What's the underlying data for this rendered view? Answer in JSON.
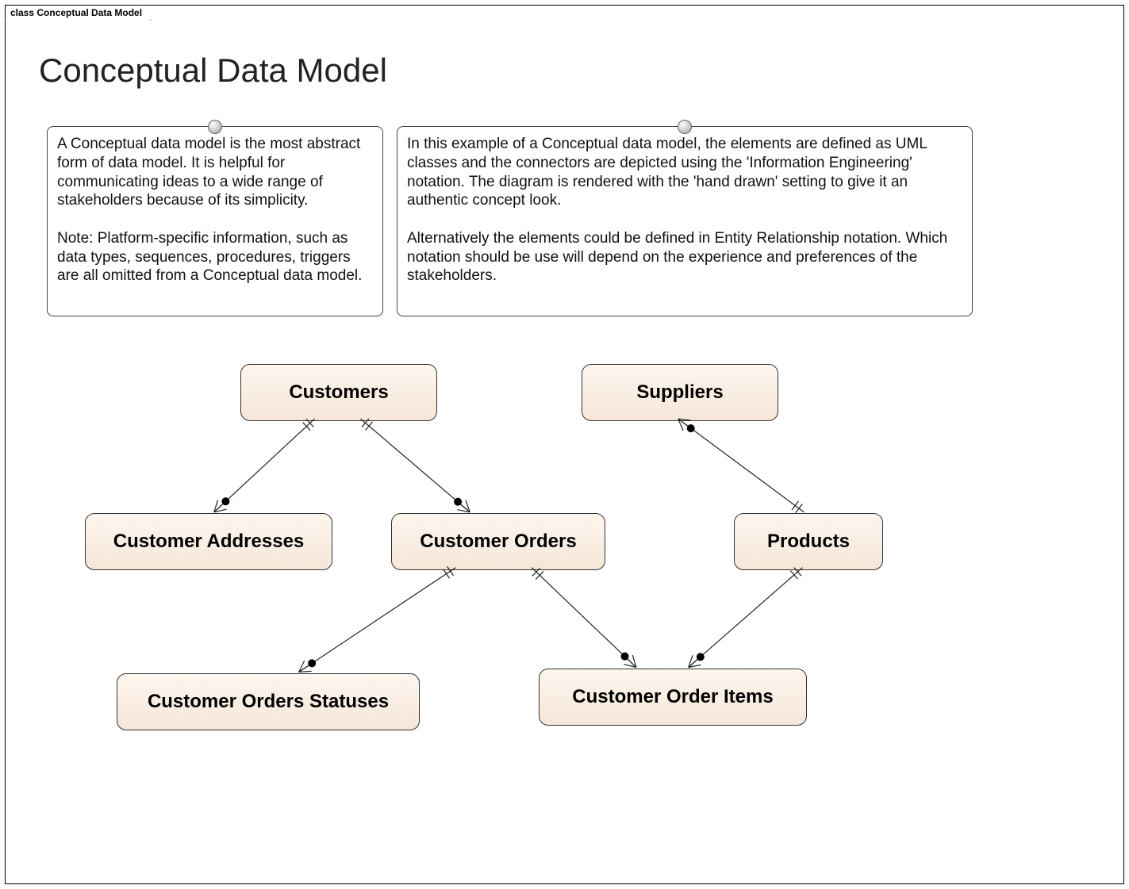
{
  "tab_label": "class Conceptual Data Model",
  "title": "Conceptual Data Model",
  "notes": {
    "left": "A Conceptual data model is the most abstract form of data model. It is helpful for communicating ideas to a wide range of stakeholders because of its simplicity.\n\nNote: Platform-specific information, such as data types, sequences, procedures, triggers are all omitted from a Conceptual data model.",
    "right": "In this example of a Conceptual data model, the elements are defined as UML classes and the connectors are depicted using the 'Information Engineering' notation.  The diagram is rendered with the 'hand drawn' setting to give it an authentic concept look.\n\nAlternatively  the elements could be defined in Entity Relationship notation. Which notation should be use will depend on the experience and preferences of the stakeholders."
  },
  "entities": {
    "customers": "Customers",
    "suppliers": "Suppliers",
    "customer_addresses": "Customer Addresses",
    "customer_orders": "Customer Orders",
    "products": "Products",
    "customer_orders_statuses": "Customer Orders Statuses",
    "customer_order_items": "Customer Order Items"
  },
  "relationships": [
    {
      "from": "customers",
      "to": "customer_addresses",
      "cardinality_from": "one",
      "cardinality_to": "many"
    },
    {
      "from": "customers",
      "to": "customer_orders",
      "cardinality_from": "one",
      "cardinality_to": "many"
    },
    {
      "from": "suppliers",
      "to": "products",
      "cardinality_from": "many",
      "cardinality_to": "one"
    },
    {
      "from": "customer_orders",
      "to": "customer_orders_statuses",
      "cardinality_from": "one",
      "cardinality_to": "many"
    },
    {
      "from": "customer_orders",
      "to": "customer_order_items",
      "cardinality_from": "one",
      "cardinality_to": "many"
    },
    {
      "from": "products",
      "to": "customer_order_items",
      "cardinality_from": "one",
      "cardinality_to": "many"
    }
  ],
  "diagram_style": "hand drawn",
  "connector_notation": "Information Engineering"
}
